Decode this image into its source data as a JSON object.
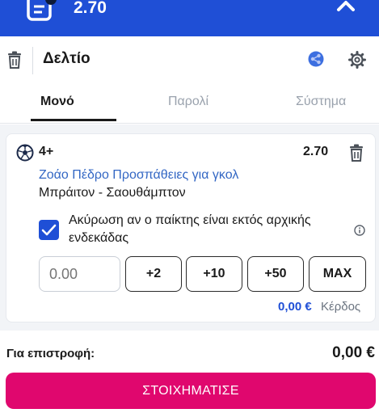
{
  "topbar": {
    "total_odds": "2.70",
    "icons": {
      "ticket": "betslip-ticket-icon",
      "collapse": "chevron-up-icon"
    }
  },
  "header": {
    "title": "Δελτίο",
    "icons": {
      "delete": "trash-icon",
      "share": "share-icon",
      "settings": "gear-icon"
    }
  },
  "tabs": [
    {
      "label": "Μονό",
      "active": true
    },
    {
      "label": "Παρολί",
      "active": false
    },
    {
      "label": "Σύστημα",
      "active": false
    }
  ],
  "bet": {
    "market": "4+",
    "odds": "2.70",
    "selection": "Ζοάο Πέδρο Προσπάθειες για γκολ",
    "event": "Μπράιτον - Σαουθάμπτον",
    "void_option": {
      "checked": true,
      "label": "Ακύρωση αν ο παίκτης είναι εκτός αρχικής ενδεκάδας"
    },
    "stake": {
      "value": "",
      "placeholder": "0.00"
    },
    "quick_stakes": [
      "+2",
      "+10",
      "+50",
      "MAX"
    ],
    "potential_win": {
      "amount": "0,00 €",
      "label": "Κέρδος"
    }
  },
  "footer": {
    "return_label": "Για επιστροφή:",
    "return_amount": "0,00 €",
    "place_bet_label": "ΣΤΟΙΧΗΜΑΤΙΣΕ"
  },
  "colors": {
    "brand_blue": "#1f4fd6",
    "place_bet_pink": "#e0076e",
    "selection_blue": "#3367c4"
  }
}
